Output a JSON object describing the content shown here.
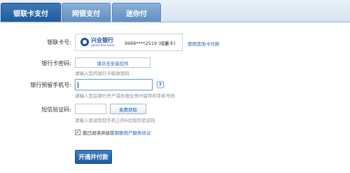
{
  "tabs": [
    {
      "label": "银联卡支付",
      "active": true
    },
    {
      "label": "网银支付",
      "active": false
    },
    {
      "label": "迷你付",
      "active": false
    }
  ],
  "card": {
    "label": "银联卡号:",
    "bank_name": "兴业银行",
    "bank_name_en": "INDUSTRIAL BANK",
    "number": "9666****2519 (储蓄卡)",
    "other_card_link": "使用其他卡付款"
  },
  "password": {
    "label": "银行卡密码:",
    "button_label": "请点击安装控件",
    "hint": "请输入您的银行卡取款密码"
  },
  "phone": {
    "label": "银行预留手机号:",
    "value": "",
    "help_icon": "?",
    "hint": "请输入您在银行开户或办理业务时留存的手机号码"
  },
  "sms": {
    "label": "短信验证码:",
    "value": "",
    "button_label": "免费获取",
    "hint": "请输入发送到您手机上的6位短信验证码"
  },
  "agreement": {
    "checked": true,
    "text": "我已阅读并接受",
    "link": "银联用户服务协议"
  },
  "submit": {
    "label": "开通并付款"
  },
  "colors": {
    "accent": "#1f5c9e",
    "link": "#1f5fb0"
  }
}
